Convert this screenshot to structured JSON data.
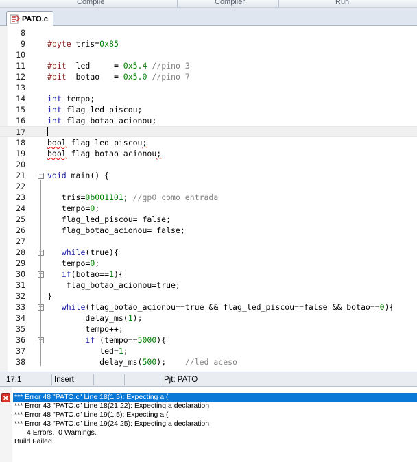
{
  "ribbon": {
    "groups": [
      "Compile",
      "Compiler",
      "Run"
    ]
  },
  "tab": {
    "label": "PATO.c",
    "icon": "c-source-file-icon"
  },
  "editor": {
    "lines": [
      {
        "n": "8",
        "code": ""
      },
      {
        "n": "9",
        "code": "#byte tris=0x85"
      },
      {
        "n": "10",
        "code": ""
      },
      {
        "n": "11",
        "code": "#bit  led     = 0x5.4 //pino 3"
      },
      {
        "n": "12",
        "code": "#bit  botao   = 0x5.0 //pino 7"
      },
      {
        "n": "13",
        "code": ""
      },
      {
        "n": "14",
        "code": "int tempo;"
      },
      {
        "n": "15",
        "code": "int flag_led_piscou;"
      },
      {
        "n": "16",
        "code": "int flag_botao_acionou;"
      },
      {
        "n": "17",
        "code": ""
      },
      {
        "n": "18",
        "code": "bool flag_led_piscou;"
      },
      {
        "n": "19",
        "code": "bool flag_botao_acionou;"
      },
      {
        "n": "20",
        "code": ""
      },
      {
        "n": "21",
        "code": "void main() {"
      },
      {
        "n": "22",
        "code": ""
      },
      {
        "n": "23",
        "code": "   tris=0b001101; //gp0 como entrada"
      },
      {
        "n": "24",
        "code": "   tempo=0;"
      },
      {
        "n": "25",
        "code": "   flag_led_piscou= false;"
      },
      {
        "n": "26",
        "code": "   flag_botao_acionou= false;"
      },
      {
        "n": "27",
        "code": ""
      },
      {
        "n": "28",
        "code": "   while(true){"
      },
      {
        "n": "29",
        "code": "   tempo=0;"
      },
      {
        "n": "30",
        "code": "   if(botao==1){"
      },
      {
        "n": "31",
        "code": "    flag_botao_acionou=true;"
      },
      {
        "n": "32",
        "code": "}"
      },
      {
        "n": "33",
        "code": "   while(flag_botao_acionou==true && flag_led_piscou==false && botao==0){"
      },
      {
        "n": "34",
        "code": "        delay_ms(1);"
      },
      {
        "n": "35",
        "code": "        tempo++;"
      },
      {
        "n": "36",
        "code": "        if (tempo==5000){"
      },
      {
        "n": "37",
        "code": "           led=1;"
      },
      {
        "n": "38",
        "code": "           delay_ms(500);    //led aceso"
      }
    ],
    "current_line": "17"
  },
  "statusbar": {
    "position": "17:1",
    "mode": "Insert",
    "project": "Pjt: PATO"
  },
  "output": {
    "lines": [
      "*** Error 48 \"PATO.c\" Line 18(1,5): Expecting a (",
      "*** Error 43 \"PATO.c\" Line 18(21,22): Expecting a declaration",
      "*** Error 48 \"PATO.c\" Line 19(1,5): Expecting a (",
      "*** Error 43 \"PATO.c\" Line 19(24,25): Expecting a declaration",
      "4 Errors,  0 Warnings.",
      "Build Failed."
    ],
    "selected_index": 0,
    "icon": "error-x-icon",
    "colors": {
      "selection": "#0a78d7",
      "error_icon": "#d8342c"
    }
  }
}
